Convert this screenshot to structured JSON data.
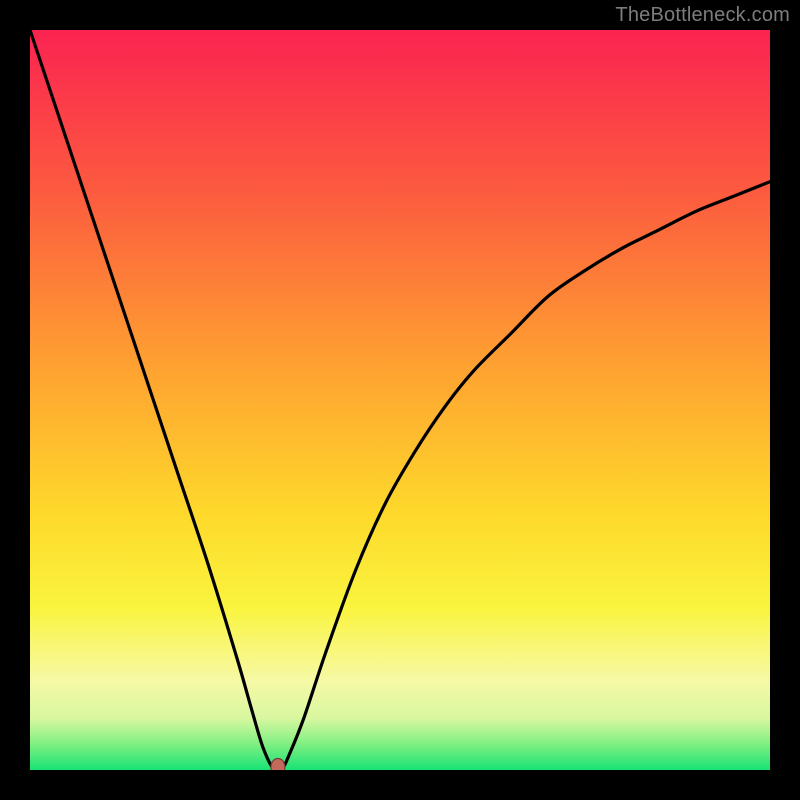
{
  "watermark": {
    "text": "TheBottleneck.com"
  },
  "colors": {
    "black": "#000000",
    "top_red_pink": "#fb2351",
    "orange": "#fd8a36",
    "yellow": "#fdea2c",
    "pale_yellow": "#f8f99a",
    "green": "#18e275",
    "curve": "#000000",
    "marker_fill": "#c46a5d",
    "marker_stroke": "#7a3b33",
    "watermark_color": "#7d7d7d"
  },
  "chart_data": {
    "type": "line",
    "title": "",
    "xlabel": "",
    "ylabel": "",
    "xlim": [
      0,
      100
    ],
    "ylim": [
      0,
      100
    ],
    "grid": false,
    "legend": null,
    "notes": "Bottleneck curve: x = normalized component balance index (0–100), y = bottleneck severity (%). Minimum ≈ 0 at x ≈ 33; left branch nearly linear from (0,100)→(33,0); right branch concave rising toward ~80% at x=100. Background vertical gradient encodes severity: green (low) → yellow → orange → red (high). Marker at the minimum.",
    "series": [
      {
        "name": "bottleneck_curve",
        "x": [
          0,
          4,
          8,
          12,
          16,
          20,
          24,
          28,
          30,
          31.5,
          33,
          34,
          35,
          37,
          40,
          44,
          48,
          52,
          56,
          60,
          65,
          70,
          75,
          80,
          85,
          90,
          95,
          100
        ],
        "y": [
          100,
          88,
          76,
          64,
          52,
          40,
          28,
          15,
          8,
          3,
          0,
          0,
          2,
          7,
          16,
          27,
          36,
          43,
          49,
          54,
          59,
          64,
          67.5,
          70.5,
          73,
          75.5,
          77.5,
          79.5
        ]
      }
    ],
    "marker": {
      "x": 33.5,
      "y": 0
    },
    "gradient_stops": [
      {
        "offset": 0.0,
        "color": "#fb2351"
      },
      {
        "offset": 0.22,
        "color": "#fc5b3f"
      },
      {
        "offset": 0.45,
        "color": "#fea031"
      },
      {
        "offset": 0.65,
        "color": "#fed82b"
      },
      {
        "offset": 0.78,
        "color": "#faf43e"
      },
      {
        "offset": 0.88,
        "color": "#f6f9a6"
      },
      {
        "offset": 0.93,
        "color": "#d9f7a0"
      },
      {
        "offset": 0.965,
        "color": "#7ff082"
      },
      {
        "offset": 1.0,
        "color": "#18e275"
      }
    ]
  }
}
